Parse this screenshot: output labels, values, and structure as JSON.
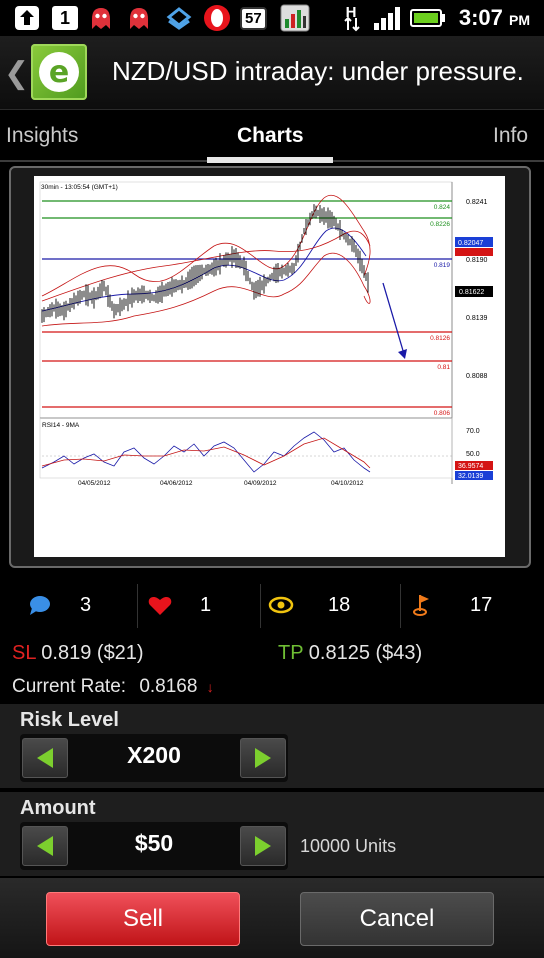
{
  "status_bar": {
    "notification_count": "1",
    "battery_badge": "57",
    "network_type": "H",
    "time": "3:07",
    "ampm": "PM"
  },
  "title_bar": {
    "title": "NZD/USD intraday: under pressure.",
    "logo_letter": "e"
  },
  "tabs": [
    {
      "label": "Insights",
      "active": false
    },
    {
      "label": "Charts",
      "active": true
    },
    {
      "label": "Info",
      "active": false
    }
  ],
  "chart": {
    "header": "30min - 13:05:54 (GMT+1)",
    "price_labels": [
      "0.8241",
      "0.824",
      "0.8226",
      "0.82047",
      "0.8190",
      "0.819",
      "0.81622",
      "0.8139",
      "0.8126",
      "0.81",
      "0.8088",
      "0.806"
    ],
    "date_labels": [
      "04/05/2012",
      "04/06/2012",
      "04/09/2012",
      "04/10/2012"
    ],
    "rsi_label": "RSI14 - 9MA",
    "rsi_levels": [
      "70.0",
      "50.0"
    ],
    "rsi_values": [
      "36.9574",
      "32.0139"
    ]
  },
  "stats": [
    {
      "icon": "comment-icon",
      "value": "3"
    },
    {
      "icon": "heart-icon",
      "value": "1"
    },
    {
      "icon": "eye-icon",
      "value": "18"
    },
    {
      "icon": "follow-icon",
      "value": "17"
    }
  ],
  "trade": {
    "sl_label": "SL",
    "sl_value": "0.819 ($21)",
    "tp_label": "TP",
    "tp_value": "0.8125 ($43)",
    "current_rate_label": "Current Rate:",
    "current_rate_value": "0.8168",
    "rate_direction": "↓"
  },
  "risk": {
    "label": "Risk Level",
    "value": "X200"
  },
  "amount": {
    "label": "Amount",
    "value": "$50",
    "units": "10000 Units"
  },
  "buttons": {
    "sell": "Sell",
    "cancel": "Cancel"
  },
  "colors": {
    "sell_red": "#d42a2f",
    "stepper_green": "#7ccf2e",
    "sl_red": "#e02222",
    "tp_green": "#6fbe34"
  }
}
